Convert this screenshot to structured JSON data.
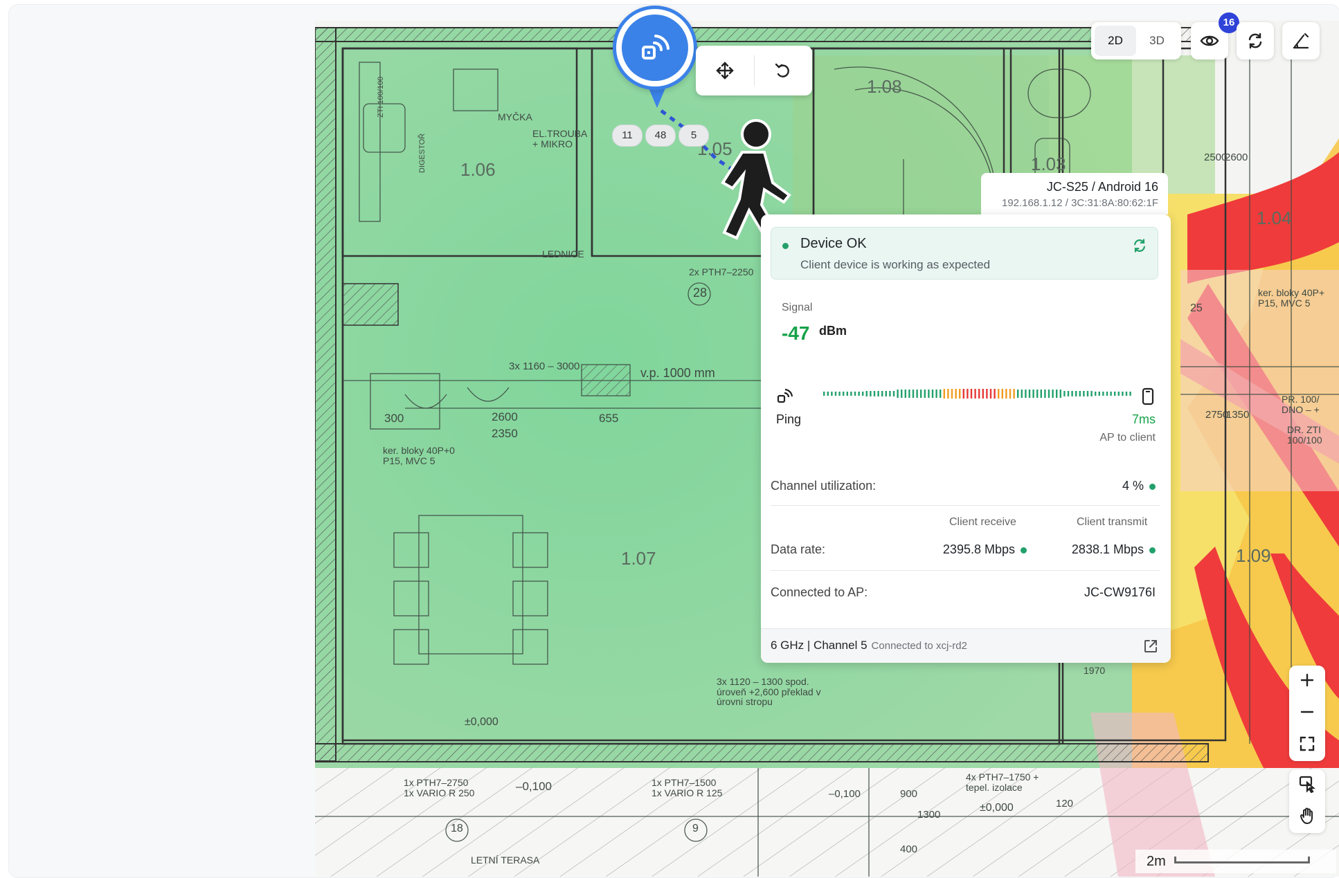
{
  "view_toggle": {
    "option_2d": "2D",
    "option_3d": "3D",
    "active": "2D"
  },
  "toolbar": {
    "visibility_badge": "16",
    "icons": [
      "eye-icon",
      "refresh-icon",
      "measure-icon"
    ]
  },
  "access_point": {
    "icon": "wifi-device-icon",
    "pills": [
      "11",
      "48",
      "5"
    ]
  },
  "move_toolbar": {
    "icons": [
      "move-icon",
      "undo-icon"
    ]
  },
  "room_labels": [
    "1.06",
    "1.08",
    "1.03",
    "1.04",
    "1.07",
    "1.09",
    "1.05"
  ],
  "plan_annotations": [
    "MYČKA",
    "EL.TROUBA + MIKRO",
    "LEDNICE",
    "DIGESTOŘ",
    "ZTI 100/100",
    "v.p. 1000 mm",
    "3x 1160 – 3000",
    "2600",
    "2350",
    "655",
    "300",
    "ker. bloky 40P+0 P15, MVC 5",
    "2x PTH7–2250",
    "28",
    "±0,000",
    "3x 1120 – 1300 spod. úroveň +2,600 překlad v úrovni stropu",
    "1x PTH7–2750 1x VARIO R 250",
    "–0,100",
    "1x PTH7–1500 1x VARIO R 125",
    "18",
    "9",
    "LETNÍ TERASA",
    "4x PTH7–1750 + tepel. izolace",
    "±0,000",
    "1970",
    "900",
    "1300",
    "400",
    "–0,100",
    "120",
    "2750",
    "1350",
    "PR. 100/ DNO – +",
    "DR. ZTI 100/100",
    "ker. bloky 40P+ P15, MVC 5",
    "25",
    "2500",
    "2600"
  ],
  "device": {
    "name": "JC-S25 / Android 16",
    "address": "192.168.1.12 / 3C:31:8A:80:62:1F"
  },
  "status": {
    "title": "Device OK",
    "subtitle": "Client device is working as expected"
  },
  "signal": {
    "label": "Signal",
    "value": "-47",
    "unit": "dBm"
  },
  "ping": {
    "label": "Ping",
    "value": "7ms",
    "sub": "AP to client"
  },
  "channel_utilization": {
    "label": "Channel utilization:",
    "value": "4 %"
  },
  "data_rate": {
    "label": "Data rate:",
    "col_receive": "Client receive",
    "col_transmit": "Client transmit",
    "receive": "2395.8 Mbps",
    "transmit": "2838.1 Mbps"
  },
  "connected_ap": {
    "label": "Connected to AP:",
    "value": "JC-CW9176I"
  },
  "footer": {
    "band": "6 GHz | Channel 5",
    "connected": "Connected to xcj-rd2"
  },
  "zoom": {
    "icons": [
      "zoom-in-icon",
      "zoom-out-icon",
      "fullscreen-icon"
    ]
  },
  "tools": {
    "icons": [
      "select-tool-icon",
      "pan-hand-icon"
    ]
  },
  "scale": {
    "label": "2m"
  },
  "colors": {
    "accent": "#3b82e8",
    "ok_green": "#16a34a",
    "badge": "#2f43d9",
    "heat_good": "#6fcf8a",
    "heat_mid": "#f3d23b",
    "heat_bad": "#ef3b3b"
  }
}
